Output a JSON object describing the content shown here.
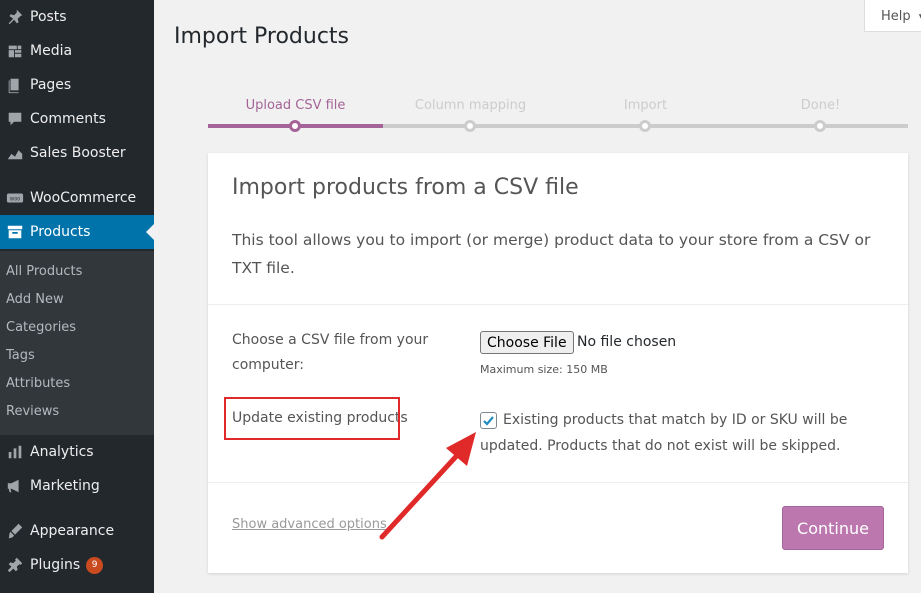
{
  "sidebar": {
    "menu": [
      {
        "name": "posts",
        "label": "Posts",
        "icon": "pin-icon"
      },
      {
        "name": "media",
        "label": "Media",
        "icon": "media-icon"
      },
      {
        "name": "pages",
        "label": "Pages",
        "icon": "pages-icon"
      },
      {
        "name": "comments",
        "label": "Comments",
        "icon": "comment-icon"
      },
      {
        "name": "sales-booster",
        "label": "Sales Booster",
        "icon": "chart-area-icon"
      },
      {
        "name": "woocommerce",
        "label": "WooCommerce",
        "icon": "woo-icon"
      },
      {
        "name": "products",
        "label": "Products",
        "icon": "archive-icon"
      },
      {
        "name": "analytics",
        "label": "Analytics",
        "icon": "bar-chart-icon"
      },
      {
        "name": "marketing",
        "label": "Marketing",
        "icon": "megaphone-icon"
      },
      {
        "name": "appearance",
        "label": "Appearance",
        "icon": "brush-icon"
      },
      {
        "name": "plugins",
        "label": "Plugins",
        "icon": "plugin-icon",
        "badge": "9"
      }
    ],
    "submenu": [
      "All Products",
      "Add New",
      "Categories",
      "Tags",
      "Attributes",
      "Reviews"
    ]
  },
  "help_label": "Help",
  "page_title": "Import Products",
  "steps": [
    "Upload CSV file",
    "Column mapping",
    "Import",
    "Done!"
  ],
  "card": {
    "title": "Import products from a CSV file",
    "description": "This tool allows you to import (or merge) product data to your store from a CSV or TXT file.",
    "file_label": "Choose a CSV file from your computer:",
    "file_button": "Choose File",
    "file_status": "No file chosen",
    "max_size": "Maximum size: 150 MB",
    "update_label": "Update existing products",
    "update_checked": true,
    "update_text": "Existing products that match by ID or SKU will be updated. Products that do not exist will be skipped.",
    "advanced_link": "Show advanced options",
    "continue_button": "Continue"
  },
  "colors": {
    "sidebar_bg": "#23282d",
    "current_menu": "#0073aa",
    "woo_purple": "#a46497",
    "button_purple": "#bb77ae",
    "annotation_red": "#e02a2a"
  }
}
